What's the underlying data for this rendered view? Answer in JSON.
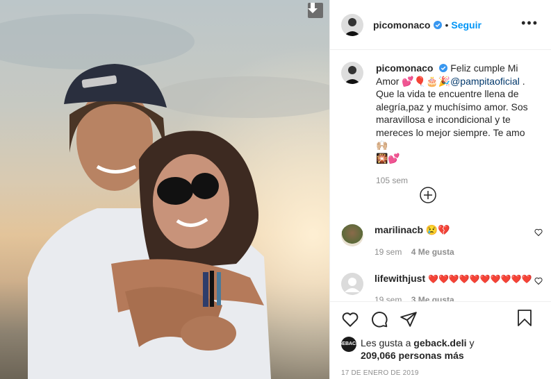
{
  "header": {
    "username": "picomonaco",
    "separator": "•",
    "follow_label": "Seguir",
    "more_label": "•••"
  },
  "caption": {
    "username": "picomonaco",
    "text_a": "Feliz cumple Mi Amor",
    "emojis_a": "💕🎈🎂🎉",
    "mention": "@pampitaoficial",
    "text_b": " . Que la vida te encuentre llena de alegría,paz y muchísimo amor. Sos maravillosa e incondicional y te mereces lo mejor siempre. Te amo",
    "emojis_b": "🙌🏼",
    "emojis_c": "🎇💕",
    "time": "105 sem"
  },
  "comments": [
    {
      "username": "marilinacb",
      "text": "😢💔",
      "time": "19 sem",
      "likes": "4 Me gusta"
    },
    {
      "username": "lifewithjust",
      "text": "❤️❤️❤️❤️❤️❤️❤️❤️❤️❤️",
      "time": "19 sem",
      "likes": "3 Me gusta"
    }
  ],
  "likes": {
    "prefix": "Les gusta a",
    "user": "geback.deli",
    "conj": "y",
    "count": "209,066 personas más",
    "avatar_text": "GEBACK"
  },
  "date": "17 DE ENERO DE 2019",
  "icons": [
    "download-icon",
    "verified-icon",
    "more-icon",
    "load-more-icon",
    "heart-icon",
    "comment-icon",
    "share-icon",
    "bookmark-icon"
  ]
}
